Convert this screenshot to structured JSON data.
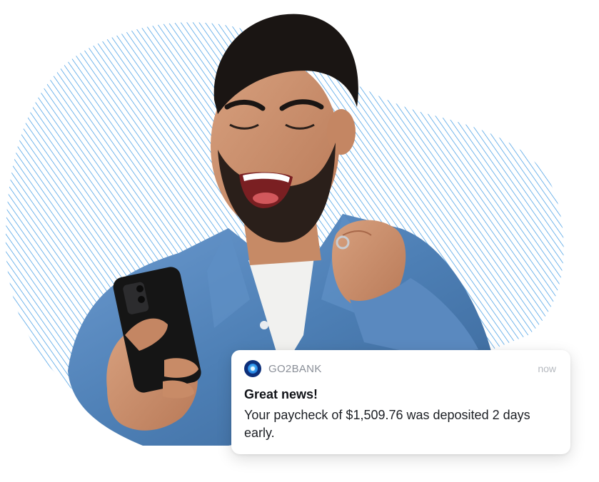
{
  "notification": {
    "app_icon": "go2bank-logo-icon",
    "app_name": "GO2BANK",
    "time": "now",
    "title": "Great news!",
    "body": "Your paycheck of $1,509.76 was deposited 2 days early."
  },
  "colors": {
    "stripe_blue": "#2a8fe0",
    "denim": "#4d7fb5",
    "shirt": "#f1f1ef"
  }
}
